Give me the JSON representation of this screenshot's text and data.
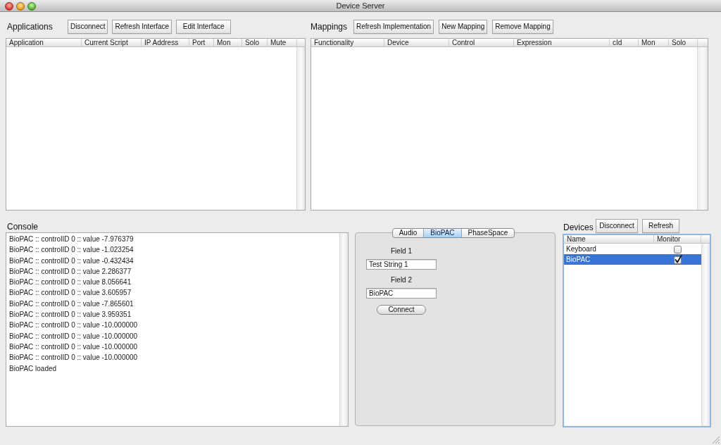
{
  "window": {
    "title": "Device Server"
  },
  "applications": {
    "title": "Applications",
    "buttons": [
      "Disconnect",
      "Refresh Interface",
      "Edit Interface"
    ],
    "table": {
      "columns": [
        "Application",
        "Current Script",
        "IP Address",
        "Port",
        "Mon",
        "Solo",
        "Mute"
      ]
    }
  },
  "mappings": {
    "title": "Mappings",
    "buttons": [
      "Refresh Implementation",
      "New Mapping",
      "Remove Mapping"
    ],
    "table": {
      "columns": [
        "Functionality",
        "Device",
        "Control",
        "Expression",
        "cId",
        "Mon",
        "Solo"
      ]
    }
  },
  "console": {
    "title": "Console",
    "lines": [
      "BioPAC :: controlID 0 :: value -7.976379",
      "BioPAC :: controlID 0 :: value -1.023254",
      "BioPAC :: controlID 0 :: value -0.432434",
      "BioPAC :: controlID 0 :: value 2.286377",
      "BioPAC :: controlID 0 :: value 8.056641",
      "BioPAC :: controlID 0 :: value 3.605957",
      "BioPAC :: controlID 0 :: value -7.865601",
      "BioPAC :: controlID 0 :: value 3.959351",
      "BioPAC :: controlID 0 :: value -10.000000",
      "BioPAC :: controlID 0 :: value -10.000000",
      "BioPAC :: controlID 0 :: value -10.000000",
      "BioPAC :: controlID 0 :: value -10.000000",
      "BioPAC loaded"
    ]
  },
  "device_settings": {
    "tabs": [
      {
        "label": "Audio",
        "selected": false
      },
      {
        "label": "BioPAC",
        "selected": true
      },
      {
        "label": "PhaseSpace",
        "selected": false
      }
    ],
    "fields": [
      {
        "label": "Field 1",
        "value": "Test String 1"
      },
      {
        "label": "Field 2",
        "value": "BioPAC"
      }
    ],
    "button": "Connect"
  },
  "devices": {
    "title": "Devices",
    "buttons": [
      "Disconnect",
      "Refresh"
    ],
    "table": {
      "columns": [
        "Name",
        "Monitor"
      ],
      "rows": [
        {
          "name": "Keyboard",
          "checked": false,
          "selected": false
        },
        {
          "name": "BioPAC",
          "checked": true,
          "selected": true
        }
      ]
    }
  }
}
